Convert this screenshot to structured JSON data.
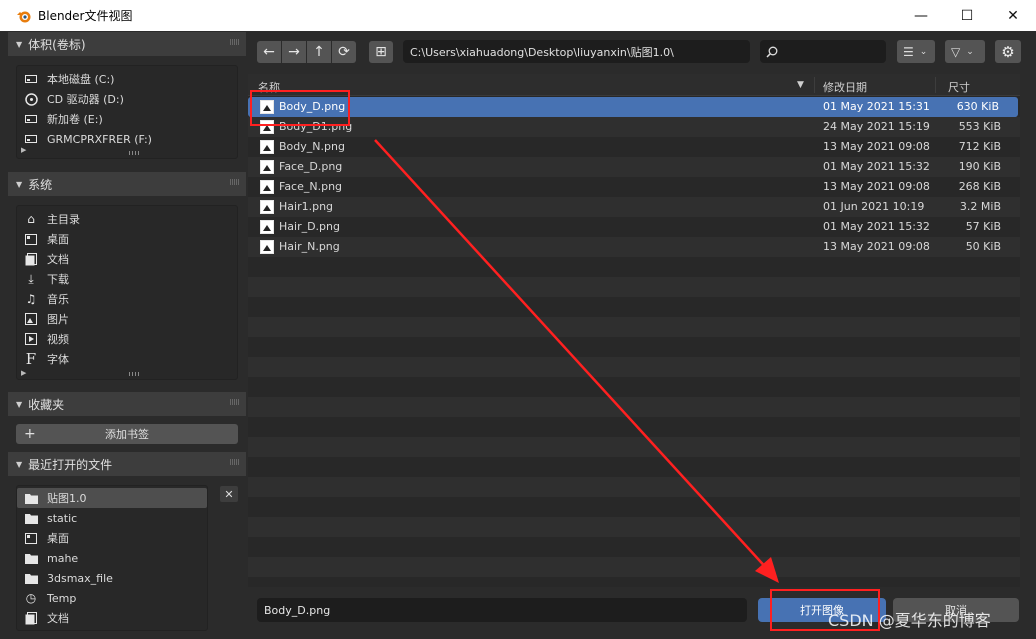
{
  "window": {
    "title": "Blender文件视图",
    "minimize": "—",
    "maximize": "☐",
    "close": "✕"
  },
  "sidebar": {
    "volumes": {
      "header": "体积(卷标)",
      "items": [
        {
          "label": "本地磁盘 (C:)",
          "icon": "drive-icon"
        },
        {
          "label": "CD 驱动器 (D:)",
          "icon": "disc-icon"
        },
        {
          "label": "新加卷 (E:)",
          "icon": "drive-icon"
        },
        {
          "label": "GRMCPRXFRER (F:)",
          "icon": "drive-icon"
        }
      ]
    },
    "system": {
      "header": "系统",
      "items": [
        {
          "label": "主目录",
          "icon": "home-icon"
        },
        {
          "label": "桌面",
          "icon": "desktop-icon"
        },
        {
          "label": "文档",
          "icon": "documents-icon"
        },
        {
          "label": "下载",
          "icon": "download-icon"
        },
        {
          "label": "音乐",
          "icon": "music-icon"
        },
        {
          "label": "图片",
          "icon": "image-icon"
        },
        {
          "label": "视频",
          "icon": "video-icon"
        },
        {
          "label": "字体",
          "icon": "font-icon"
        }
      ]
    },
    "bookmarks": {
      "header": "收藏夹",
      "add_label": "添加书签"
    },
    "recent": {
      "header": "最近打开的文件",
      "items": [
        {
          "label": "贴图1.0",
          "icon": "folder-icon"
        },
        {
          "label": "static",
          "icon": "folder-icon"
        },
        {
          "label": "桌面",
          "icon": "desktop-icon"
        },
        {
          "label": "mahe",
          "icon": "folder-icon"
        },
        {
          "label": "3dsmax_file",
          "icon": "folder-icon"
        },
        {
          "label": "Temp",
          "icon": "clock-icon"
        },
        {
          "label": "文档",
          "icon": "documents-icon"
        }
      ]
    }
  },
  "toolbar": {
    "path": "C:\\Users\\xiahuadong\\Desktop\\liuyanxin\\贴图1.0\\",
    "search_placeholder": ""
  },
  "columns": {
    "name": "名称",
    "date": "修改日期",
    "size": "尺寸"
  },
  "files": [
    {
      "name": "Body_D.png",
      "date": "01 May 2021 15:31",
      "size": "630 KiB",
      "selected": true
    },
    {
      "name": "Body_D1.png",
      "date": "24 May 2021 15:19",
      "size": "553 KiB"
    },
    {
      "name": "Body_N.png",
      "date": "13 May 2021 09:08",
      "size": "712 KiB"
    },
    {
      "name": "Face_D.png",
      "date": "01 May 2021 15:32",
      "size": "190 KiB"
    },
    {
      "name": "Face_N.png",
      "date": "13 May 2021 09:08",
      "size": "268 KiB"
    },
    {
      "name": "Hair1.png",
      "date": "01 Jun 2021 10:19",
      "size": "3.2 MiB"
    },
    {
      "name": "Hair_D.png",
      "date": "01 May 2021 15:32",
      "size": "57 KiB"
    },
    {
      "name": "Hair_N.png",
      "date": "13 May 2021 09:08",
      "size": "50 KiB"
    }
  ],
  "footer": {
    "filename": "Body_D.png",
    "open_label": "打开图像",
    "cancel_label": "取消"
  },
  "watermark": "CSDN @夏华东的博客",
  "colors": {
    "selection": "#4772b3",
    "annotation": "#ff2020"
  }
}
